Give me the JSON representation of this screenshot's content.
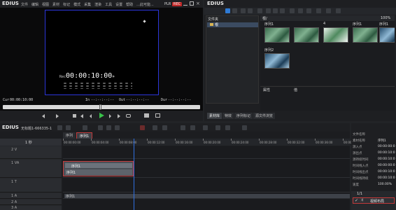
{
  "player": {
    "app": "EDIUS",
    "menu": [
      "文件",
      "编辑",
      "视图",
      "素材",
      "标记",
      "模式",
      "采集",
      "渲染",
      "工具",
      "设置",
      "帮助",
      "...此可能..."
    ],
    "mode_tags": [
      "PLR",
      "REC"
    ],
    "timecode": "00:00:10:00",
    "timecode_suffix": "»",
    "cue": {
      "cur_label": "Cur",
      "cur": "00:00:10:00",
      "in_label": "In",
      "in": "--:--:--:--",
      "out_label": "Out",
      "out": "--:--:--:--",
      "dur_label": "Dur",
      "dur": "--:--:--:--"
    },
    "row_markers": [
      "Cur 00:00:10:00",
      "In --:--:--:--",
      "Out --:--:--:--",
      "Dur --:--:--:--"
    ]
  },
  "bin": {
    "app": "EDIUS",
    "tree_header": "文件夹",
    "root": "根",
    "path": "根/",
    "zoom": "100%",
    "items": [
      {
        "label": "序列1"
      },
      {
        "label": ""
      },
      {
        "label": "4"
      },
      {
        "label": "序列1"
      },
      {
        "label": "序列1"
      },
      {
        "label": "序列2"
      }
    ],
    "properties_header": "属性",
    "value_header": "值",
    "tabs": [
      "素材库",
      "特效",
      "序列标记",
      "源文件浏览"
    ]
  },
  "timeline": {
    "app": "EDIUS",
    "project": "无标题1-666335-1",
    "seq_tabs": [
      "序列",
      "序列1"
    ],
    "ruler_times": [
      "00:00:00:00",
      "00:00:04:00",
      "00:00:08:00",
      "00:00:12:00",
      "00:00:16:00",
      "00:00:20:00",
      "00:00:24:00",
      "00:00:28:00",
      "00:00:32:00",
      "00:00:36:00",
      "00:00:40:00"
    ],
    "tracks": [
      {
        "name": "2 V"
      },
      {
        "name": "1 VA"
      },
      {
        "name": "1 T"
      },
      {
        "name": "1 A"
      },
      {
        "name": "2 A"
      },
      {
        "name": "3 A"
      }
    ],
    "scale_label": "1 秒",
    "clip_top": "序列1",
    "clip_bottom": "序列1",
    "clip_audio": "序列1",
    "playhead_time": "00:00:10:00"
  },
  "info": {
    "rows": [
      {
        "k": "文件名称",
        "v": ""
      },
      {
        "k": "素材名称",
        "v": "序列1"
      },
      {
        "k": "源入点",
        "v": "00:00:00:0"
      },
      {
        "k": "源出点",
        "v": "00:00:10:0"
      },
      {
        "k": "源持续时间",
        "v": "00:00:10:0"
      },
      {
        "k": "时间线入点",
        "v": "00:00:00:0"
      },
      {
        "k": "时间线出点",
        "v": "00:00:10:0"
      },
      {
        "k": "时间线持续",
        "v": "00:00:10:0"
      },
      {
        "k": "速度",
        "v": "100.00%"
      }
    ],
    "counter": "1/1",
    "effect_label": "视频布局"
  }
}
